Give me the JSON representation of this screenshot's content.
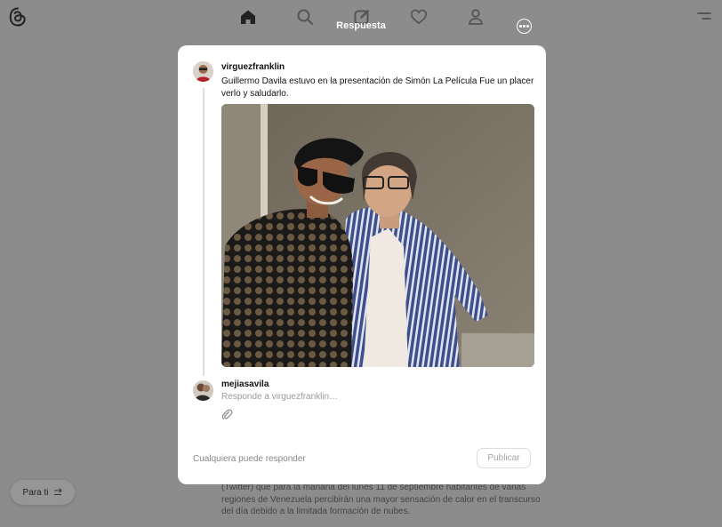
{
  "app": {
    "nav": [
      "home-icon",
      "search-icon",
      "compose-icon",
      "heart-icon",
      "profile-icon"
    ],
    "feed_switch": {
      "label": "Para ti",
      "icon": "swap-icon"
    },
    "background_text": "(Twitter) que para la mañana del lunes 11 de septiembre habitantes de varias regiones de Venezuela percibirán una mayor sensación de calor en el transcurso del día debido a la limitada formación de nubes."
  },
  "dialog": {
    "title": "Respuesta",
    "original_post": {
      "username": "virguezfranklin",
      "text": "Guillermo Davila estuvo en la presentación de Simón La Película Fue un placer verlo y saludarlo."
    },
    "reply": {
      "username": "mejiasavila",
      "placeholder": "Responde a virguezfranklin…",
      "value": ""
    },
    "footer": {
      "audience": "Cualquiera puede responder",
      "publish_label": "Publicar"
    }
  },
  "colors": {
    "overlay_bg": "#8c8c8c",
    "modal_bg": "#ffffff",
    "muted_text": "#999999",
    "publish_disabled": "#a5a5a5"
  }
}
